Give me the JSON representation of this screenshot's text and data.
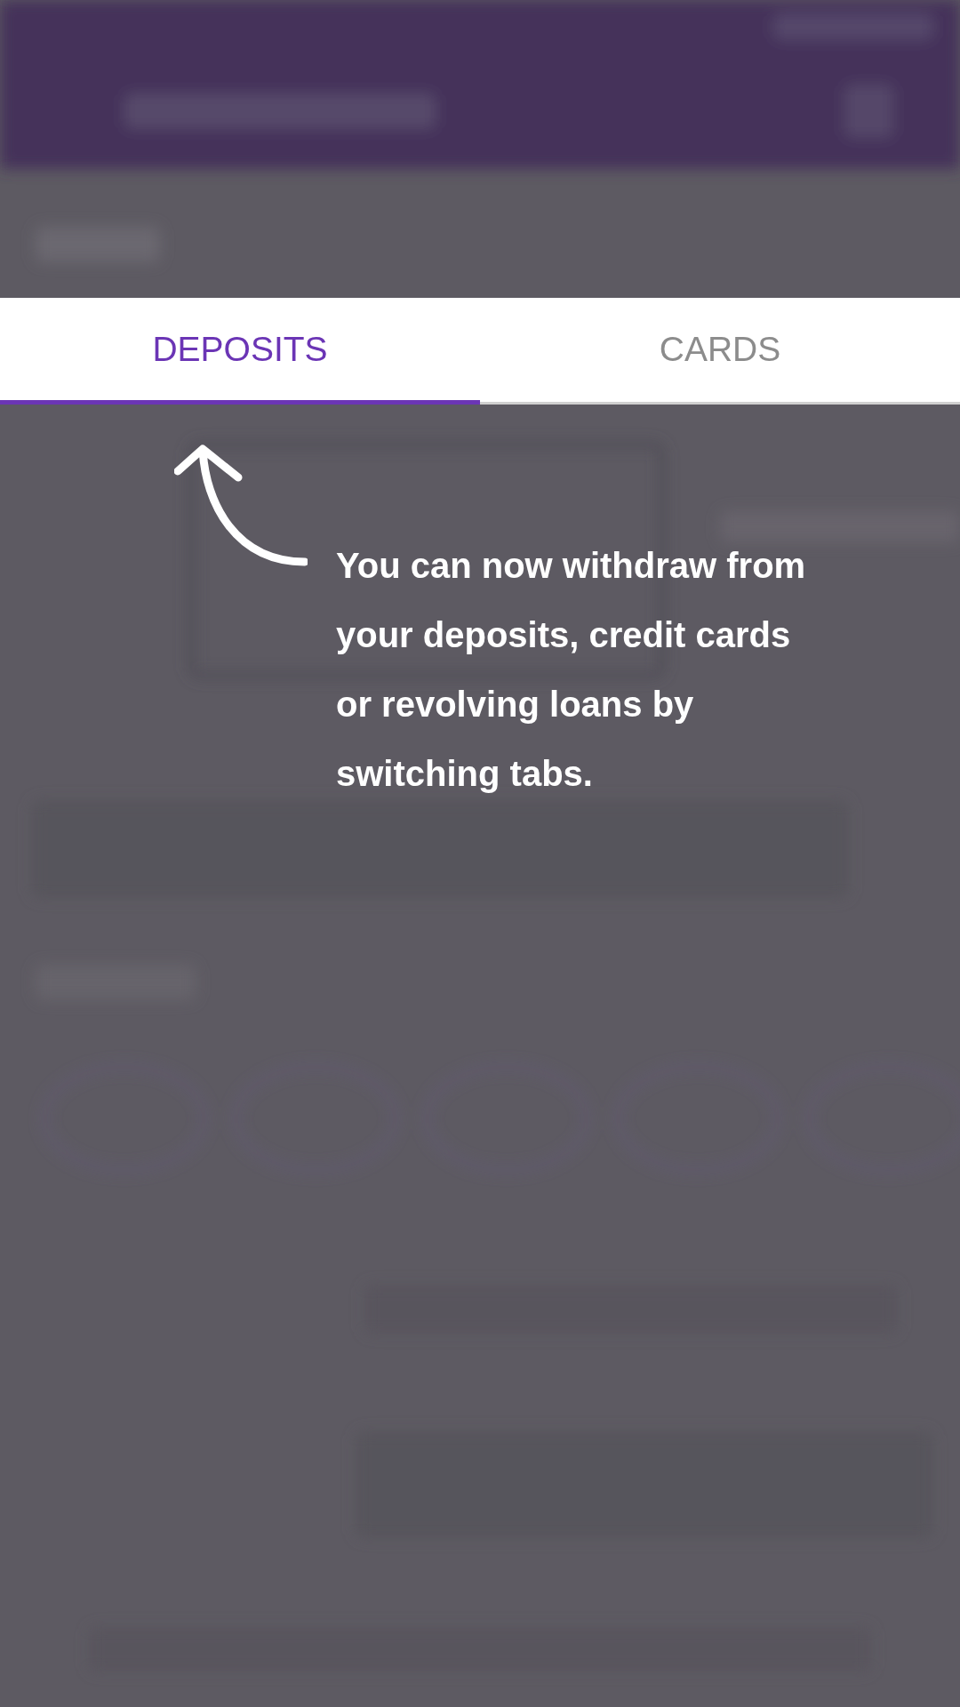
{
  "tabs": [
    {
      "label": "DEPOSITS",
      "selected": true
    },
    {
      "label": "CARDS",
      "selected": false
    }
  ],
  "tip": {
    "text": "You can now withdraw from your deposits, credit cards or revolving loans by switching tabs."
  }
}
